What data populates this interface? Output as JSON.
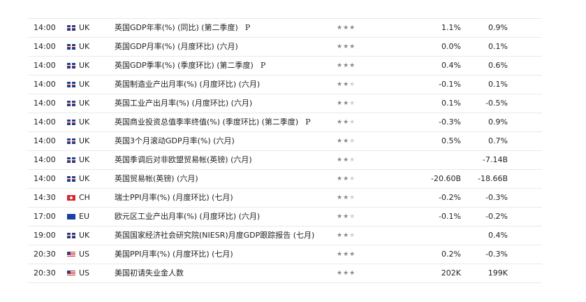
{
  "rows": [
    {
      "time": "14:00",
      "country": "UK",
      "flag": "uk",
      "event": "英国GDP年率(%) (同比) (第二季度)",
      "prelim": "P",
      "importance": 3,
      "actual": "1.1%",
      "forecast": "0.9%"
    },
    {
      "time": "14:00",
      "country": "UK",
      "flag": "uk",
      "event": "英国GDP月率(%) (月度环比) (六月)",
      "prelim": "",
      "importance": 3,
      "actual": "0.0%",
      "forecast": "0.1%"
    },
    {
      "time": "14:00",
      "country": "UK",
      "flag": "uk",
      "event": "英国GDP季率(%) (季度环比) (第二季度)",
      "prelim": "P",
      "importance": 3,
      "actual": "0.4%",
      "forecast": "0.6%"
    },
    {
      "time": "14:00",
      "country": "UK",
      "flag": "uk",
      "event": "英国制造业产出月率(%) (月度环比) (六月)",
      "prelim": "",
      "importance": 2,
      "actual": "-0.1%",
      "forecast": "0.1%"
    },
    {
      "time": "14:00",
      "country": "UK",
      "flag": "uk",
      "event": "英国工业产出月率(%) (月度环比) (六月)",
      "prelim": "",
      "importance": 2,
      "actual": "0.1%",
      "forecast": "-0.5%"
    },
    {
      "time": "14:00",
      "country": "UK",
      "flag": "uk",
      "event": "英国商业投资总值季率终值(%) (季度环比) (第二季度)",
      "prelim": "P",
      "importance": 2,
      "actual": "-0.3%",
      "forecast": "0.9%"
    },
    {
      "time": "14:00",
      "country": "UK",
      "flag": "uk",
      "event": "英国3个月滚动GDP月率(%) (六月)",
      "prelim": "",
      "importance": 2,
      "actual": "0.5%",
      "forecast": "0.7%"
    },
    {
      "time": "14:00",
      "country": "UK",
      "flag": "uk",
      "event": "英国季调后对非欧盟贸易帐(英镑) (六月)",
      "prelim": "",
      "importance": 2,
      "actual": "",
      "forecast": "-7.14B"
    },
    {
      "time": "14:00",
      "country": "UK",
      "flag": "uk",
      "event": "英国贸易帐(英镑) (六月)",
      "prelim": "",
      "importance": 2,
      "actual": "-20.60B",
      "forecast": "-18.66B"
    },
    {
      "time": "14:30",
      "country": "CH",
      "flag": "ch",
      "event": "瑞士PPI月率(%) (月度环比) (七月)",
      "prelim": "",
      "importance": 2,
      "actual": "-0.2%",
      "forecast": "-0.3%"
    },
    {
      "time": "17:00",
      "country": "EU",
      "flag": "eu",
      "event": "欧元区工业产出月率(%) (月度环比) (六月)",
      "prelim": "",
      "importance": 2,
      "actual": "-0.1%",
      "forecast": "-0.2%"
    },
    {
      "time": "19:00",
      "country": "UK",
      "flag": "uk",
      "event": "英国国家经济社会研究院(NIESR)月度GDP跟踪报告 (七月)",
      "prelim": "",
      "importance": 2,
      "actual": "",
      "forecast": "0.4%"
    },
    {
      "time": "20:30",
      "country": "US",
      "flag": "us",
      "event": "美国PPI月率(%) (月度环比) (七月)",
      "prelim": "",
      "importance": 3,
      "actual": "0.2%",
      "forecast": "-0.3%"
    },
    {
      "time": "20:30",
      "country": "US",
      "flag": "us",
      "event": "美国初请失业金人数",
      "prelim": "",
      "importance": 3,
      "actual": "202K",
      "forecast": "199K"
    }
  ]
}
